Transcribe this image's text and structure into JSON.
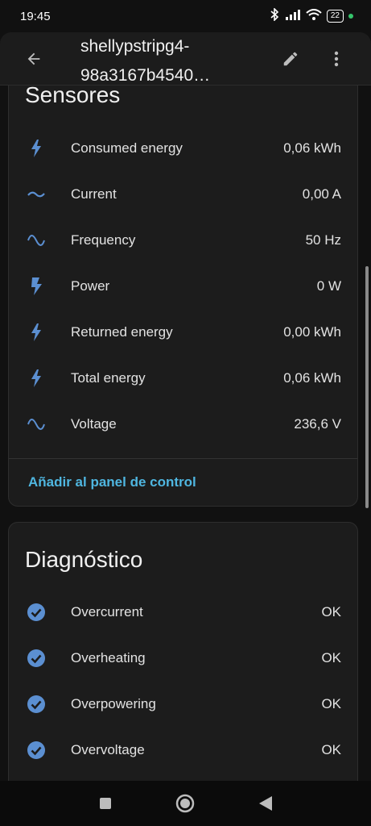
{
  "status_bar": {
    "time": "19:45",
    "battery": "22"
  },
  "toolbar": {
    "title": "shellypstripg4-98a3167b4540…"
  },
  "sensors": {
    "title": "Sensores",
    "rows": [
      {
        "icon": "flash-icon",
        "label": "Consumed energy",
        "value": "0,06 kWh"
      },
      {
        "icon": "current-ac-icon",
        "label": "Current",
        "value": "0,00 A"
      },
      {
        "icon": "sine-wave-icon",
        "label": "Frequency",
        "value": "50 Hz"
      },
      {
        "icon": "flash-bold-icon",
        "label": "Power",
        "value": "0 W"
      },
      {
        "icon": "flash-icon",
        "label": "Returned energy",
        "value": "0,00 kWh"
      },
      {
        "icon": "flash-icon",
        "label": "Total energy",
        "value": "0,06 kWh"
      },
      {
        "icon": "sine-wave-icon",
        "label": "Voltage",
        "value": "236,6 V"
      }
    ],
    "add_link": "Añadir al panel de control"
  },
  "diagnostics": {
    "title": "Diagnóstico",
    "rows": [
      {
        "icon": "check-circle-icon",
        "label": "Overcurrent",
        "value": "OK"
      },
      {
        "icon": "check-circle-icon",
        "label": "Overheating",
        "value": "OK"
      },
      {
        "icon": "check-circle-icon",
        "label": "Overpowering",
        "value": "OK"
      },
      {
        "icon": "check-circle-icon",
        "label": "Overvoltage",
        "value": "OK"
      }
    ]
  },
  "colors": {
    "accent_link": "#4fb6e0",
    "icon_blue": "#5b8fd1",
    "card_bg": "#1c1c1c"
  }
}
